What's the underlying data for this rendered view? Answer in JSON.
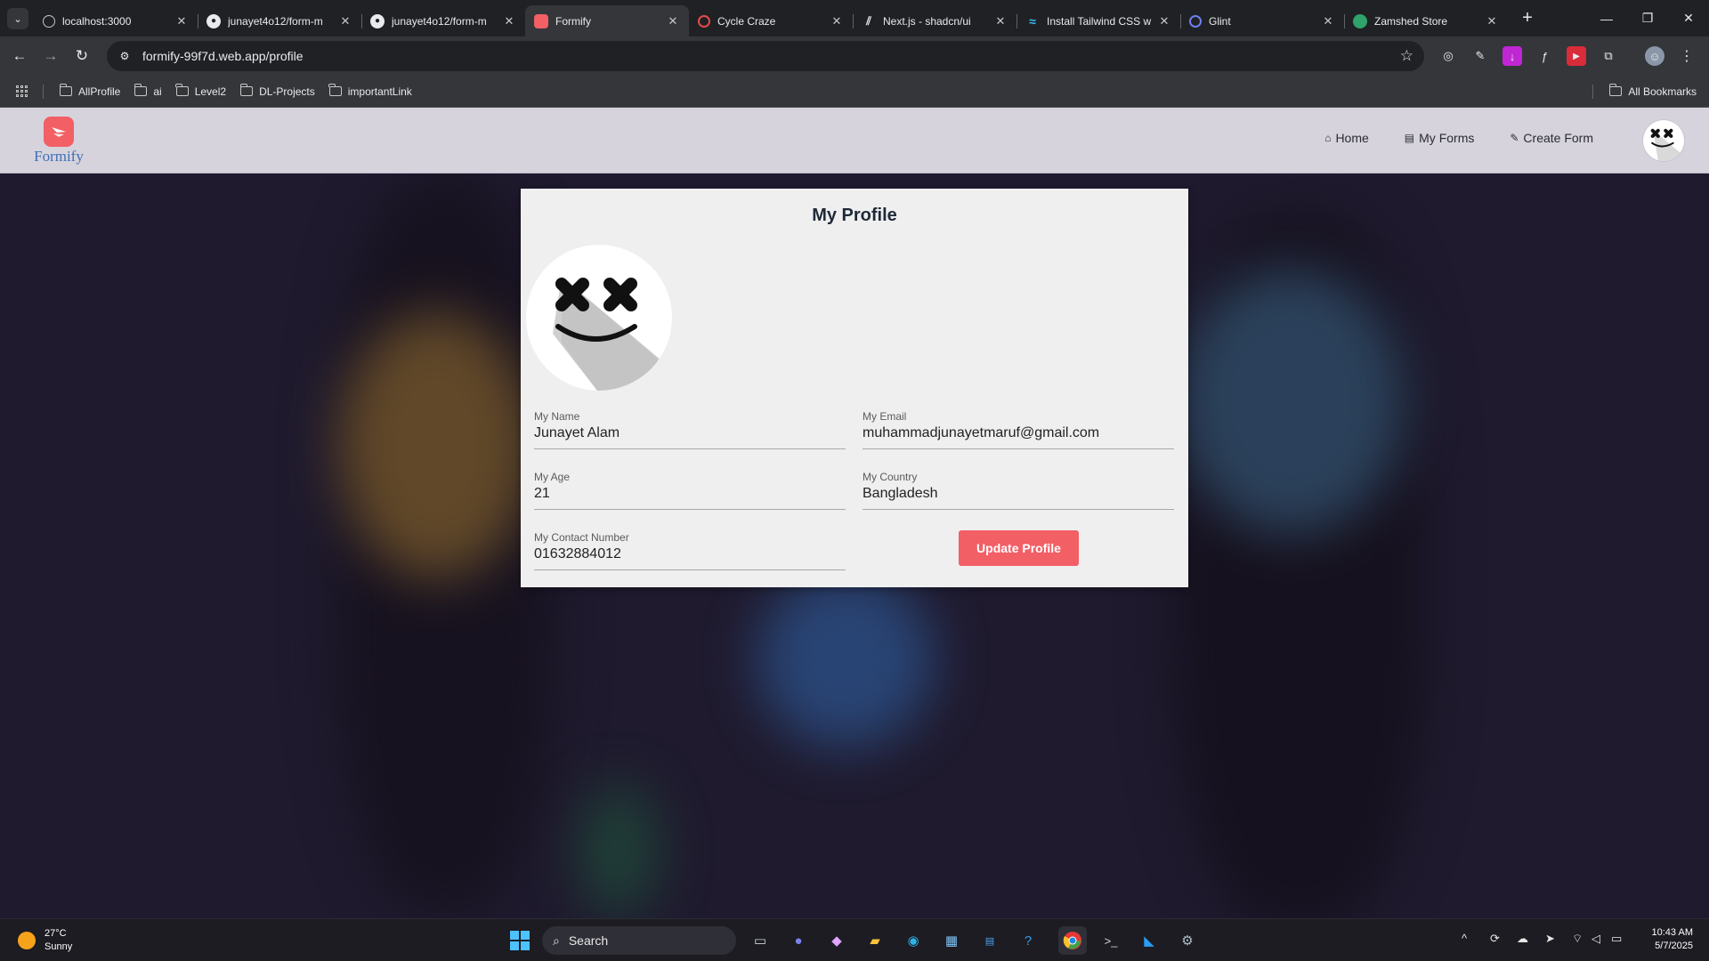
{
  "browser": {
    "tabs": [
      {
        "title": "localhost:3000",
        "favicon": "globe-icon",
        "active": false
      },
      {
        "title": "junayet4o12/form-m",
        "favicon": "github-icon",
        "active": false
      },
      {
        "title": "junayet4o12/form-m",
        "favicon": "github-icon",
        "active": false
      },
      {
        "title": "Formify",
        "favicon": "formify-icon",
        "active": true
      },
      {
        "title": "Cycle Craze",
        "favicon": "cycle-icon",
        "active": false
      },
      {
        "title": "Next.js - shadcn/ui",
        "favicon": "shadcn-icon",
        "active": false
      },
      {
        "title": "Install Tailwind CSS w",
        "favicon": "tailwind-icon",
        "active": false
      },
      {
        "title": "Glint",
        "favicon": "glint-icon",
        "active": false
      },
      {
        "title": "Zamshed Store",
        "favicon": "store-icon",
        "active": false
      }
    ],
    "url": "formify-99f7d.web.app/profile",
    "bookmarks": [
      "AllProfile",
      "ai",
      "Level2",
      "DL-Projects",
      "importantLink"
    ],
    "all_bookmarks_label": "All Bookmarks"
  },
  "site": {
    "logo_text": "Formify",
    "nav": {
      "home": "Home",
      "my_forms": "My Forms",
      "create_form": "Create Form"
    },
    "accent_color": "#f25f65"
  },
  "profile": {
    "title": "My Profile",
    "fields": {
      "name": {
        "label": "My Name",
        "value": "Junayet Alam"
      },
      "email": {
        "label": "My Email",
        "value": "muhammadjunayetmaruf@gmail.com"
      },
      "age": {
        "label": "My Age",
        "value": "21"
      },
      "country": {
        "label": "My Country",
        "value": "Bangladesh"
      },
      "contact": {
        "label": "My Contact Number",
        "value": "01632884012"
      }
    },
    "update_button": "Update Profile"
  },
  "taskbar": {
    "weather_temp": "27°C",
    "weather_desc": "Sunny",
    "search_label": "Search",
    "time": "10:43 AM",
    "date": "5/7/2025"
  }
}
